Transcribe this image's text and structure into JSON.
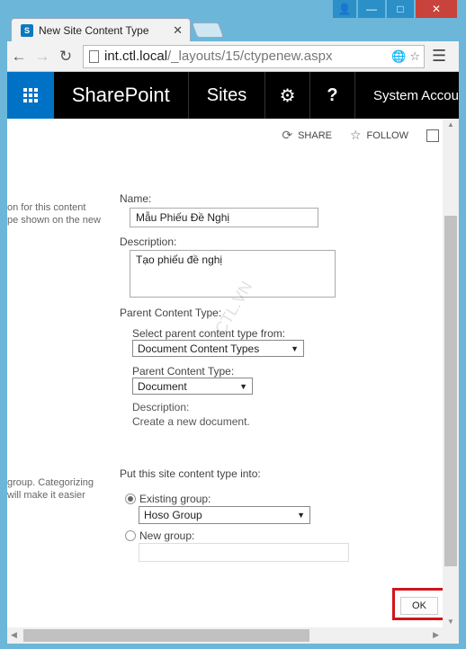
{
  "browser": {
    "tab_title": "New Site Content Type",
    "tab_favicon": "S",
    "url_host": "int.ctl.local",
    "url_path": "/_layouts/15/ctypenew.aspx"
  },
  "suitebar": {
    "brand": "SharePoint",
    "sites": "Sites",
    "settings_icon": "gear-icon",
    "help_label": "?",
    "account": "System Accou"
  },
  "page_actions": {
    "share": "SHARE",
    "follow": "FOLLOW"
  },
  "left_desc": {
    "line1": "on for this content",
    "line2": "pe shown on the new",
    "line3": "group. Categorizing",
    "line4": "will make it easier"
  },
  "form": {
    "name_label": "Name:",
    "name_value": "Mẫu Phiếu Đề Nghị",
    "description_label": "Description:",
    "description_value": "Tạo phiếu đề nghị",
    "parent_type_label": "Parent Content Type:",
    "select_from_label": "Select parent content type from:",
    "select_from_value": "Document Content Types",
    "parent_type_sub_label": "Parent Content Type:",
    "parent_type_value": "Document",
    "parent_desc_label": "Description:",
    "parent_desc_value": "Create a new document.",
    "put_into_label": "Put this site content type into:",
    "existing_group_label": "Existing group:",
    "existing_group_value": "Hoso Group",
    "new_group_label": "New group:",
    "new_group_value": "",
    "ok_label": "OK"
  },
  "watermark": "CTL.VN"
}
